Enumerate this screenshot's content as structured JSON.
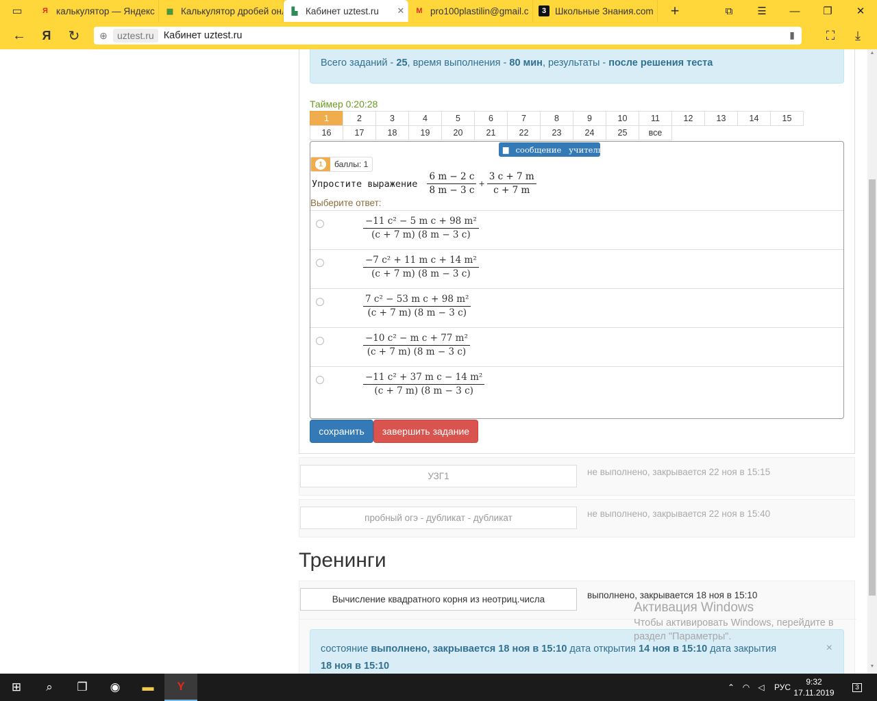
{
  "browser": {
    "tabs": [
      {
        "title": "калькулятор — Яндекс",
        "icon": "yandex-y-icon",
        "active": false
      },
      {
        "title": "Калькулятор дробей онл",
        "icon": "grid-icon",
        "active": false
      },
      {
        "title": "Кабинет uztest.ru",
        "icon": "uztest-icon",
        "active": true
      },
      {
        "title": "pro100plastilin@gmail.c",
        "icon": "gmail-icon",
        "active": false
      },
      {
        "title": "Школьные Знания.com",
        "icon": "znanija-icon",
        "active": false
      }
    ],
    "new_tab": "+",
    "address": {
      "domain": "uztest.ru",
      "title": "Кабинет uztest.ru"
    }
  },
  "info": {
    "p1": "Всего заданий - ",
    "count": "25",
    "p2": ", время выполнения - ",
    "time": "80 мин",
    "p3": ", результаты - ",
    "results": "после решения теста"
  },
  "timer": "Таймер 0:20:28",
  "question_nav": {
    "row1": [
      "1",
      "2",
      "3",
      "4",
      "5",
      "6",
      "7",
      "8",
      "9",
      "10",
      "11",
      "12",
      "13",
      "14",
      "15"
    ],
    "row2": [
      "16",
      "17",
      "18",
      "19",
      "20",
      "21",
      "22",
      "23",
      "24",
      "25",
      "все"
    ],
    "selected": "1"
  },
  "question": {
    "message_btn": "сообщение   учителю",
    "number": "1",
    "points": "баллы: 1",
    "prompt": "Упростите выражение",
    "expr": [
      {
        "num": "6 m − 2 c",
        "den": "8 m − 3 c"
      },
      {
        "op": "+"
      },
      {
        "num": "3 c + 7 m",
        "den": "c + 7 m"
      }
    ],
    "choose_label": "Выберите ответ:",
    "options": [
      {
        "num": "−11 c² − 5 m c + 98 m²",
        "den": "(c + 7 m) (8 m − 3 c)"
      },
      {
        "num": "−7 c² + 11 m c + 14 m²",
        "den": "(c + 7 m) (8 m − 3 c)"
      },
      {
        "num": "7 c² − 53 m c + 98 m²",
        "den": "(c + 7 m) (8 m − 3 c)"
      },
      {
        "num": "−10 c² − m c + 77 m²",
        "den": "(c + 7 m) (8 m − 3 c)"
      },
      {
        "num": "−11 c² + 37 m c − 14 m²",
        "den": "(c + 7 m) (8 m − 3 c)"
      }
    ]
  },
  "buttons": {
    "save": "сохранить",
    "finish": "завершить задание"
  },
  "tasks": [
    {
      "name": "УЗГ1",
      "status": "не выполнено, закрывается 22 ноя в 15:15"
    },
    {
      "name": "пробный огэ - дубликат - дубликат",
      "status": "не выполнено, закрывается 22 ноя в 15:40"
    }
  ],
  "trainings": {
    "heading": "Тренинги",
    "item": {
      "name": "Вычисление квадратного корня из неотриц.числа",
      "status": "выполнено, закрывается 18 ноя в 15:10"
    },
    "alert": {
      "l1": "состояние ",
      "state": "выполнено, закрывается 18 ноя в 15:10",
      "l2": " дата открытия ",
      "open": "14 ноя в 15:10",
      "l3": " дата закрытия",
      "close": "18 ноя в 15:10",
      "close_btn": "×"
    }
  },
  "watermark": {
    "title": "Активация Windows",
    "text": "Чтобы активировать Windows, перейдите в раздел \"Параметры\"."
  },
  "taskbar": {
    "lang": "РУС",
    "time": "9:32",
    "date": "17.11.2019",
    "notifications": "3"
  }
}
